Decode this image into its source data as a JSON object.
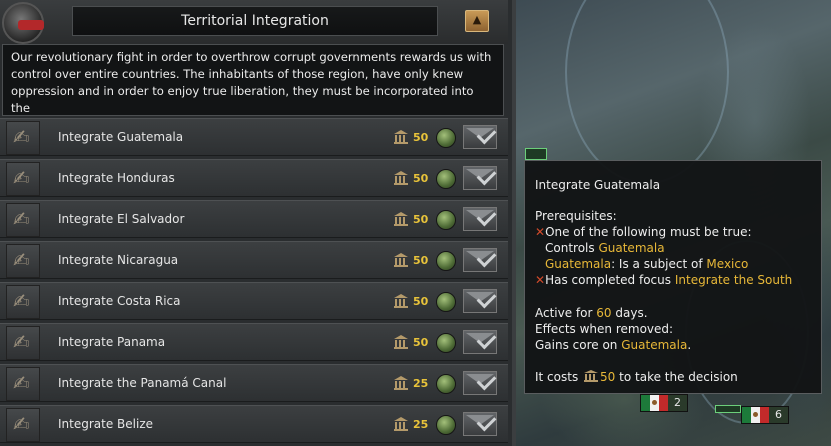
{
  "panel": {
    "title": "Territorial Integration",
    "collapse_icon": "chevron-up-icon",
    "description": "Our revolutionary fight in order to overthrow corrupt governments rewards us with control over entire countries. The inhabitants of those region, have only knew oppression and in order to enjoy true liberation, they must be incorporated into the"
  },
  "decisions": [
    {
      "name": "Integrate Guatemala",
      "cost": "50"
    },
    {
      "name": "Integrate Honduras",
      "cost": "50"
    },
    {
      "name": "Integrate El Salvador",
      "cost": "50"
    },
    {
      "name": "Integrate Nicaragua",
      "cost": "50"
    },
    {
      "name": "Integrate Costa Rica",
      "cost": "50"
    },
    {
      "name": "Integrate Panama",
      "cost": "50"
    },
    {
      "name": "Integrate the Panamá Canal",
      "cost": "25"
    },
    {
      "name": "Integrate Belize",
      "cost": "25"
    }
  ],
  "tooltip": {
    "title": "Integrate Guatemala",
    "prerequisites_label": "Prerequisites:",
    "one_of": "One of the following must be true:",
    "controls_text": "Controls",
    "controls_target": "Guatemala",
    "subject_country": "Guatemala",
    "subject_text": ": Is a subject of",
    "subject_overlord": "Mexico",
    "focus_text": "Has completed focus",
    "focus_name": "Integrate the South",
    "active_text_pre": "Active for",
    "active_days": "60",
    "active_text_post": "days.",
    "effects_label": "Effects when removed:",
    "gains_text": "Gains core on",
    "gains_target": "Guatemala",
    "gains_end": ".",
    "costs_pre": "It costs",
    "costs_value": "50",
    "costs_post": "to take the decision"
  },
  "map": {
    "flag_numbers": [
      "2",
      "6"
    ]
  },
  "colors": {
    "highlight": "#e8b838",
    "cost": "#e8c33a",
    "fail": "#d04a2a"
  }
}
